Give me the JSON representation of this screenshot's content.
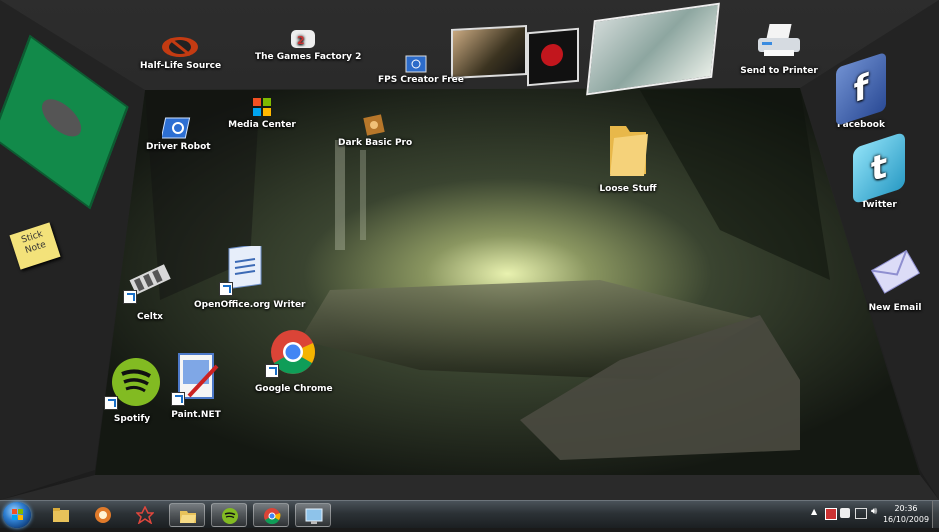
{
  "desktop": {
    "icons": {
      "half_life": "Half-Life Source",
      "games_factory": "The Games Factory 2",
      "fps_creator": "FPS Creator Free",
      "send_printer": "Send to Printer",
      "facebook": "Facebook",
      "twitter": "Twitter",
      "new_email": "New Email",
      "driver_robot": "Driver Robot",
      "media_center": "Media Center",
      "dark_basic": "Dark Basic Pro",
      "loose_stuff": "Loose Stuff",
      "celtx": "Celtx",
      "openoffice": "OpenOffice.org Writer",
      "google_chrome": "Google Chrome",
      "spotify": "Spotify",
      "paint_net": "Paint.NET"
    },
    "sticky_note": "Stick Note"
  },
  "taskbar": {
    "pinned": [
      "start-orb",
      "windows-explorer",
      "media-player",
      "app-flash",
      "folder",
      "spotify",
      "chrome",
      "remote-desktop"
    ],
    "clock_time": "20:36",
    "clock_date": "16/10/2009"
  }
}
